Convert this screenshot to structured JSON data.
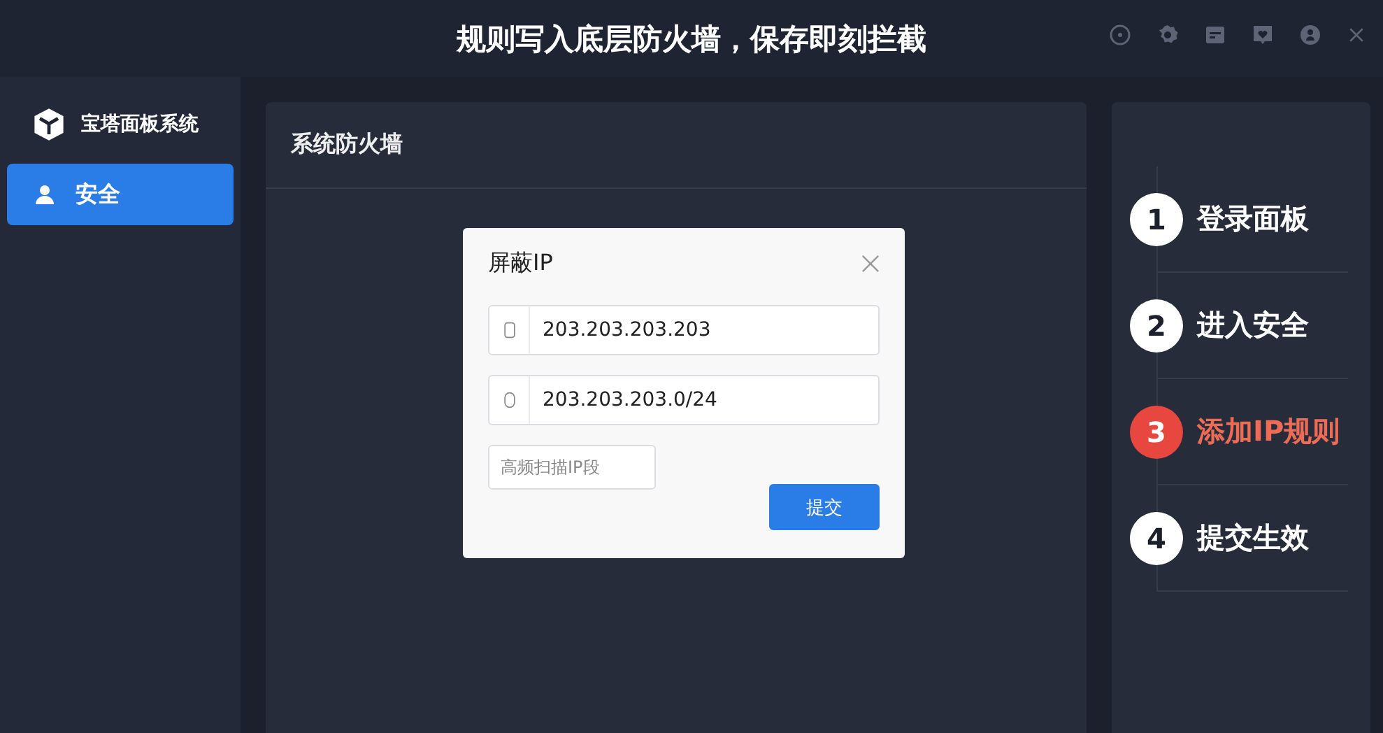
{
  "window": {
    "title": "规则写入底层防火墙，保存即刻拦截"
  },
  "sidebar": {
    "brand": "宝塔面板系统",
    "items": [
      {
        "label": "安全",
        "selected": true
      }
    ]
  },
  "panel": {
    "title": "系统防火墙"
  },
  "dialog": {
    "title": "屏蔽IP",
    "fields": [
      {
        "value": "203.203.203.203"
      },
      {
        "value": "203.203.203.0/24"
      }
    ],
    "tag": {
      "placeholder": "高频扫描IP段"
    },
    "button": "提交"
  },
  "steps": [
    {
      "number": "1",
      "label": "登录面板",
      "selected": false
    },
    {
      "number": "2",
      "label": "进入安全",
      "selected": false
    },
    {
      "number": "3",
      "label": "添加IP规则",
      "selected": true
    },
    {
      "number": "4",
      "label": "提交生效",
      "selected": false
    }
  ]
}
